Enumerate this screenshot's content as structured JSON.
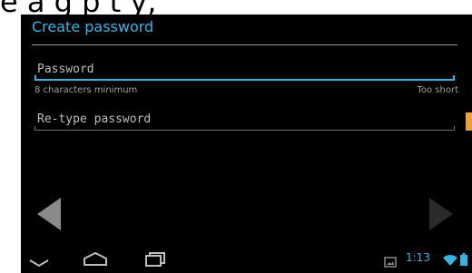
{
  "header_snippet": "e  a   g  p            t    y,",
  "screen": {
    "title": "Create password",
    "password": {
      "placeholder": "Password",
      "hint": "8 characters minimum",
      "status": "Too short"
    },
    "retype": {
      "placeholder": "Re-type password"
    }
  },
  "status_bar": {
    "time": "1:13"
  },
  "colors": {
    "accent": "#33b5e5",
    "background": "#000000",
    "edge_tab": "#f0a030"
  },
  "icons": {
    "prev": "left-arrow-icon",
    "next": "right-arrow-icon",
    "back": "back-icon",
    "home": "home-icon",
    "recent": "recent-apps-icon",
    "notification": "picture-icon",
    "wifi": "wifi-icon",
    "battery": "battery-icon"
  }
}
